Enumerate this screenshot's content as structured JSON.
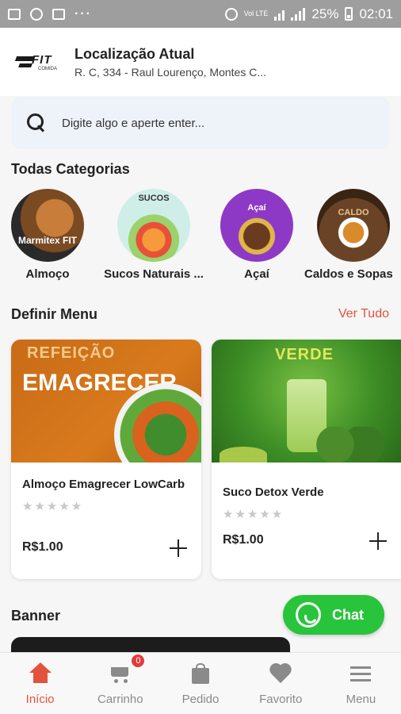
{
  "status_bar": {
    "battery": "25%",
    "time": "02:01",
    "network": "Vol LTE"
  },
  "header": {
    "logo_text": "FIT",
    "logo_sub": "COMIDA",
    "title": "Localização Atual",
    "address": "R. C, 334 - Raul Lourenço, Montes C..."
  },
  "search": {
    "placeholder": "Digite algo e aperte enter..."
  },
  "categories": {
    "title": "Todas Categorias",
    "items": [
      {
        "label": "Almoço",
        "image_text": "Marmitex FIT"
      },
      {
        "label": "Sucos Naturais  ...",
        "image_text": "SUCOS"
      },
      {
        "label": "Açaí",
        "image_text": "Açaí"
      },
      {
        "label": "Caldos e Sopas",
        "image_text": "CALDO"
      }
    ]
  },
  "menu": {
    "title": "Definir Menu",
    "see_all": "Ver Tudo",
    "products": [
      {
        "image_heading": "REFEIÇÃO",
        "image_title": "EMAGRECER",
        "name": "Almoço Emagrecer LowCarb",
        "price": "R$1.00",
        "rating": 0
      },
      {
        "image_heading": "VERDE",
        "image_title": "",
        "name": "Suco Detox Verde",
        "price": "R$1.00",
        "rating": 0
      }
    ]
  },
  "banner": {
    "title": "Banner"
  },
  "chat": {
    "label": "Chat",
    "icon": "whatsapp-icon",
    "color": "#28c43b"
  },
  "bottom_nav": {
    "accent": "#e2533d",
    "items": [
      {
        "label": "Início",
        "icon": "home-icon",
        "active": true
      },
      {
        "label": "Carrinho",
        "icon": "cart-icon",
        "badge": "0"
      },
      {
        "label": "Pedido",
        "icon": "bag-icon"
      },
      {
        "label": "Favorito",
        "icon": "heart-icon"
      },
      {
        "label": "Menu",
        "icon": "menu-icon"
      }
    ]
  }
}
